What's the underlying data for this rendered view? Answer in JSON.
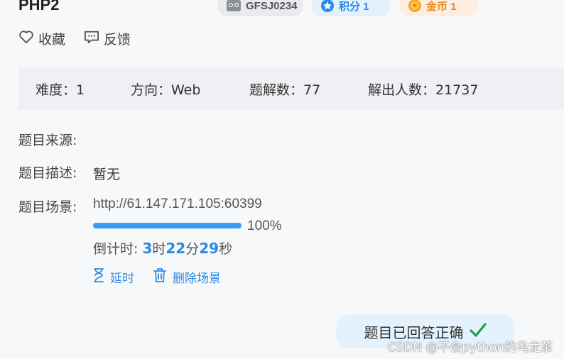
{
  "header": {
    "title": "PHP2"
  },
  "badges": {
    "id": "GFSJ0234",
    "score": "积分 1",
    "coin": "金币 1"
  },
  "actions": {
    "favorite": "收藏",
    "feedback": "反馈"
  },
  "info": {
    "difficulty": "难度：1",
    "direction": "方向：Web",
    "solved_count": "题解数：77",
    "solver_count": "解出人数：21737"
  },
  "fields": {
    "source_label": "题目来源:",
    "desc_label": "题目描述:",
    "desc_value": "暂无",
    "scene_label": "题目场景:"
  },
  "scene": {
    "url": "http://61.147.171.105:60399",
    "progress": 100,
    "progress_text": "100%",
    "countdown_label": "倒计时: ",
    "hours": "3",
    "hours_unit": "时",
    "minutes": "22",
    "minutes_unit": "分",
    "seconds": "29",
    "seconds_unit": "秒",
    "extend_label": "延时",
    "delete_label": "删除场景"
  },
  "answered": {
    "text": "题目已回答正确"
  },
  "watermark": "CSDN @不会python的乌龙茶",
  "colors": {
    "accent": "#2b8ae6",
    "progress": "#3d9bf6",
    "check": "#1aa34a"
  },
  "icons": [
    "avatar-icon",
    "star-badge-icon",
    "coin-icon",
    "heart-icon",
    "comment-icon",
    "hourglass-icon",
    "trash-icon",
    "check-icon"
  ]
}
